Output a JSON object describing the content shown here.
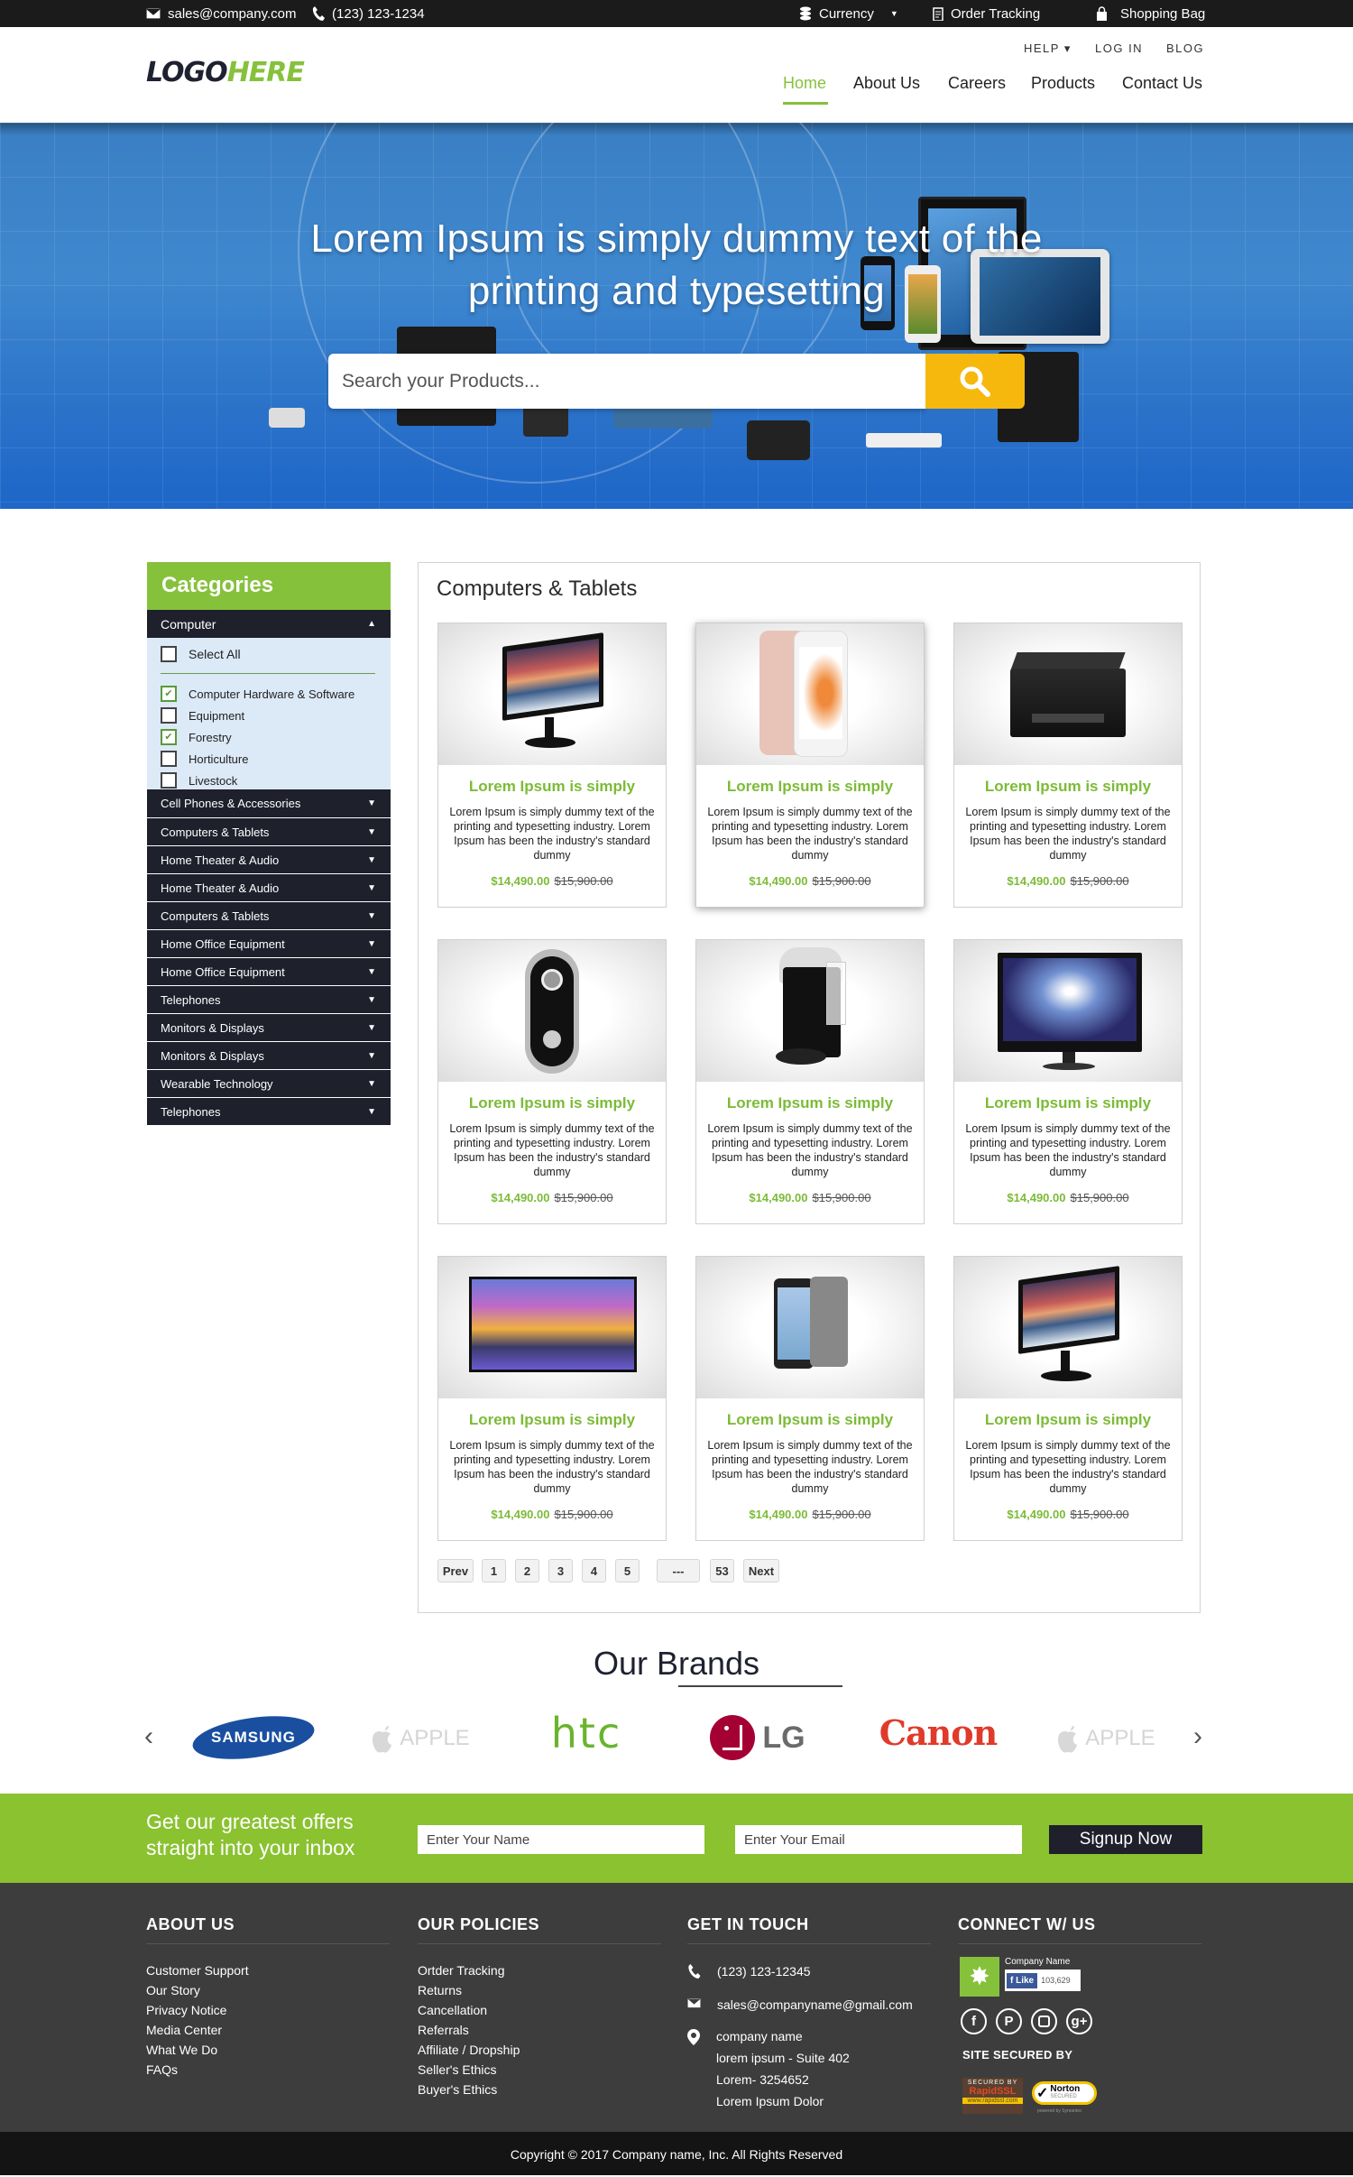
{
  "topbar": {
    "email": "sales@company.com",
    "phone": "(123) 123-1234",
    "currency": "Currency",
    "order_tracking": "Order Tracking",
    "shopping_bag": "Shopping Bag"
  },
  "header": {
    "logo_part1": "LOGO",
    "logo_part2": "HERE",
    "util_links": [
      "HELP ▾",
      "LOG IN",
      "BLOG"
    ],
    "nav": [
      "Home",
      "About Us",
      "Careers",
      "Products",
      "Contact Us"
    ],
    "active_nav": "Home"
  },
  "hero": {
    "title": "Lorem Ipsum is simply dummy text of the printing and typesetting",
    "search_placeholder": "Search your Products...",
    "search_value": ""
  },
  "sidebar": {
    "title": "Categories",
    "open_category": "Computer",
    "select_all": "Select All",
    "options": [
      {
        "label": "Computer Hardware & Software",
        "checked": true
      },
      {
        "label": "Equipment",
        "checked": false
      },
      {
        "label": "Forestry",
        "checked": true
      },
      {
        "label": "Horticulture",
        "checked": false
      },
      {
        "label": "Livestock",
        "checked": false
      }
    ],
    "categories": [
      "Cell Phones & Accessories",
      "Computers & Tablets",
      "Home Theater & Audio",
      "Home Theater & Audio",
      "Computers & Tablets",
      "Home Office Equipment",
      "Home Office Equipment",
      "Telephones",
      "Monitors & Displays",
      "Monitors & Displays",
      "Wearable Technology",
      "Telephones"
    ]
  },
  "main": {
    "title": "Computers & Tablets",
    "products": [
      {
        "image": "monitor",
        "title": "Lorem Ipsum is simply",
        "desc": "Lorem Ipsum is simply dummy text of the printing and typesetting industry. Lorem Ipsum has been the industry's standard dummy",
        "price": "$14,490.00",
        "old_price": "$15,900.00"
      },
      {
        "image": "smartphone",
        "title": "Lorem Ipsum is simply",
        "desc": "Lorem Ipsum is simply dummy text of the printing and typesetting industry. Lorem Ipsum has been the industry's standard dummy",
        "price": "$14,490.00",
        "old_price": "$15,900.00"
      },
      {
        "image": "printer",
        "title": "Lorem Ipsum is simply",
        "desc": "Lorem Ipsum is simply dummy text of the printing and typesetting industry. Lorem Ipsum has been the industry's standard dummy",
        "price": "$14,490.00",
        "old_price": "$15,900.00"
      },
      {
        "image": "doorbell-camera",
        "title": "Lorem Ipsum is simply",
        "desc": "Lorem Ipsum is simply dummy text of the printing and typesetting industry. Lorem Ipsum has been the industry's standard dummy",
        "price": "$14,490.00",
        "old_price": "$15,900.00"
      },
      {
        "image": "coffee-maker",
        "title": "Lorem Ipsum is simply",
        "desc": "Lorem Ipsum is simply dummy text of the printing and typesetting industry. Lorem Ipsum has been the industry's standard dummy",
        "price": "$14,490.00",
        "old_price": "$15,900.00"
      },
      {
        "image": "asus-monitor",
        "title": "Lorem Ipsum is simply",
        "desc": "Lorem Ipsum is simply dummy text of the printing and typesetting industry. Lorem Ipsum has been the industry's standard dummy",
        "price": "$14,490.00",
        "old_price": "$15,900.00"
      },
      {
        "image": "tv",
        "title": "Lorem Ipsum is simply",
        "desc": "Lorem Ipsum is simply dummy text of the printing and typesetting industry. Lorem Ipsum has been the industry's standard dummy",
        "price": "$14,490.00",
        "old_price": "$15,900.00"
      },
      {
        "image": "tablet",
        "title": "Lorem Ipsum is simply",
        "desc": "Lorem Ipsum is simply dummy text of the printing and typesetting industry. Lorem Ipsum has been the industry's standard dummy",
        "price": "$14,490.00",
        "old_price": "$15,900.00"
      },
      {
        "image": "monitor",
        "title": "Lorem Ipsum is simply",
        "desc": "Lorem Ipsum is simply dummy text of the printing and typesetting industry. Lorem Ipsum has been the industry's standard dummy",
        "price": "$14,490.00",
        "old_price": "$15,900.00"
      }
    ],
    "pagination": [
      "Prev",
      "1",
      "2",
      "3",
      "4",
      "5",
      "---",
      "53",
      "Next"
    ]
  },
  "brands": {
    "title": "Our Brands",
    "items": [
      "SAMSUNG",
      "APPLE",
      "htc",
      "LG",
      "Canon",
      "APPLE"
    ]
  },
  "newsletter": {
    "text_line1": "Get our greatest offers",
    "text_line2": "straight into your inbox",
    "name_placeholder": "Enter Your Name",
    "email_placeholder": "Enter Your Email",
    "button": "Signup Now"
  },
  "footer": {
    "about": {
      "title": "ABOUT US",
      "links": [
        "Customer Support",
        "Our Story",
        "Privacy Notice",
        "Media Center",
        "What We Do",
        "FAQs"
      ]
    },
    "policies": {
      "title": "OUR POLICIES",
      "links": [
        "Ortder Tracking",
        "Returns",
        "Cancellation",
        "Referrals",
        "Affiliate / Dropship",
        "Seller's Ethics",
        "Buyer's Ethics"
      ]
    },
    "touch": {
      "title": "GET IN TOUCH",
      "phone": "(123) 123-12345",
      "email": "sales@companyname@gmail.com",
      "address": [
        "company name",
        "lorem ipsum - Suite 402",
        "Lorem- 3254652",
        "Lorem Ipsum Dolor"
      ]
    },
    "connect": {
      "title": "CONNECT W/ US",
      "fb_page_name": "Company Name",
      "fb_like": "Like",
      "fb_count": "103,629",
      "secured_by": "SITE SECURED BY",
      "badge1_top": "SECURED BY",
      "badge1_main": "RapidSSL",
      "badge1_url": "www.rapidssl.com",
      "badge2_main": "Norton",
      "badge2_sub": "SECURED",
      "badge2_powered": "powered by Symantec"
    },
    "copyright": "Copyright © 2017 Company name, Inc. All Rights Reserved"
  },
  "colors": {
    "brand_green": "#86c13c",
    "dark_navy": "#1e202c",
    "search_yellow": "#f6b80d",
    "footer_gray": "#3d3d3d"
  }
}
